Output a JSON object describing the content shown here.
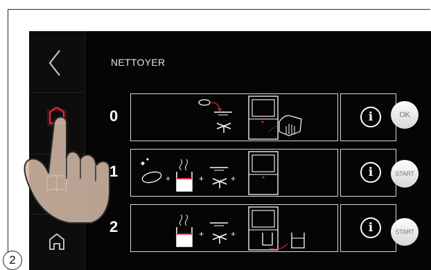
{
  "header": {
    "title": "NETTOYER"
  },
  "sidebar": {
    "items": [
      {
        "icon": "back-chevron-icon"
      },
      {
        "icon": "menu-icon",
        "active": true,
        "accent": "#e0243a"
      },
      {
        "icon": "book-icon"
      },
      {
        "icon": "home-icon"
      }
    ]
  },
  "steps": [
    {
      "number": "0",
      "info_label": "i",
      "action_label": "OK"
    },
    {
      "number": "1",
      "info_label": "i",
      "action_label": "START"
    },
    {
      "number": "2",
      "info_label": "i",
      "action_label": "START"
    }
  ],
  "badge": {
    "label": "2"
  },
  "colors": {
    "screen": "#050505",
    "accent": "#e0243a",
    "line": "#d9d9d9"
  }
}
